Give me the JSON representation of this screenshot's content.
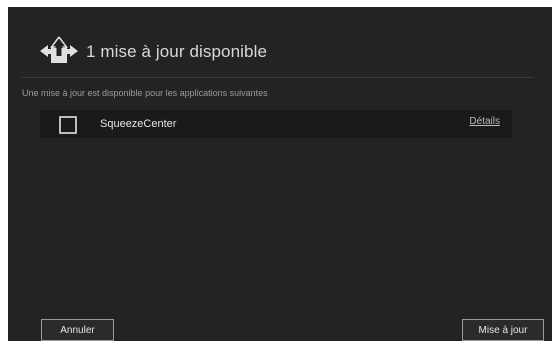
{
  "dialog": {
    "title": "1 mise à jour disponible",
    "subtitle": "Une mise à jour est disponible pour les applications suivantes"
  },
  "updates": [
    {
      "name": "SqueezeCenter",
      "details_label": "Détails",
      "checked": false
    }
  ],
  "buttons": {
    "cancel_label": "Annuler",
    "update_label": "Mise à jour"
  },
  "icons": {
    "header_icon": "update-arrow-icon"
  },
  "colors": {
    "background": "#232323",
    "row_background": "#1a1a1a",
    "text": "#e6e6e6"
  }
}
